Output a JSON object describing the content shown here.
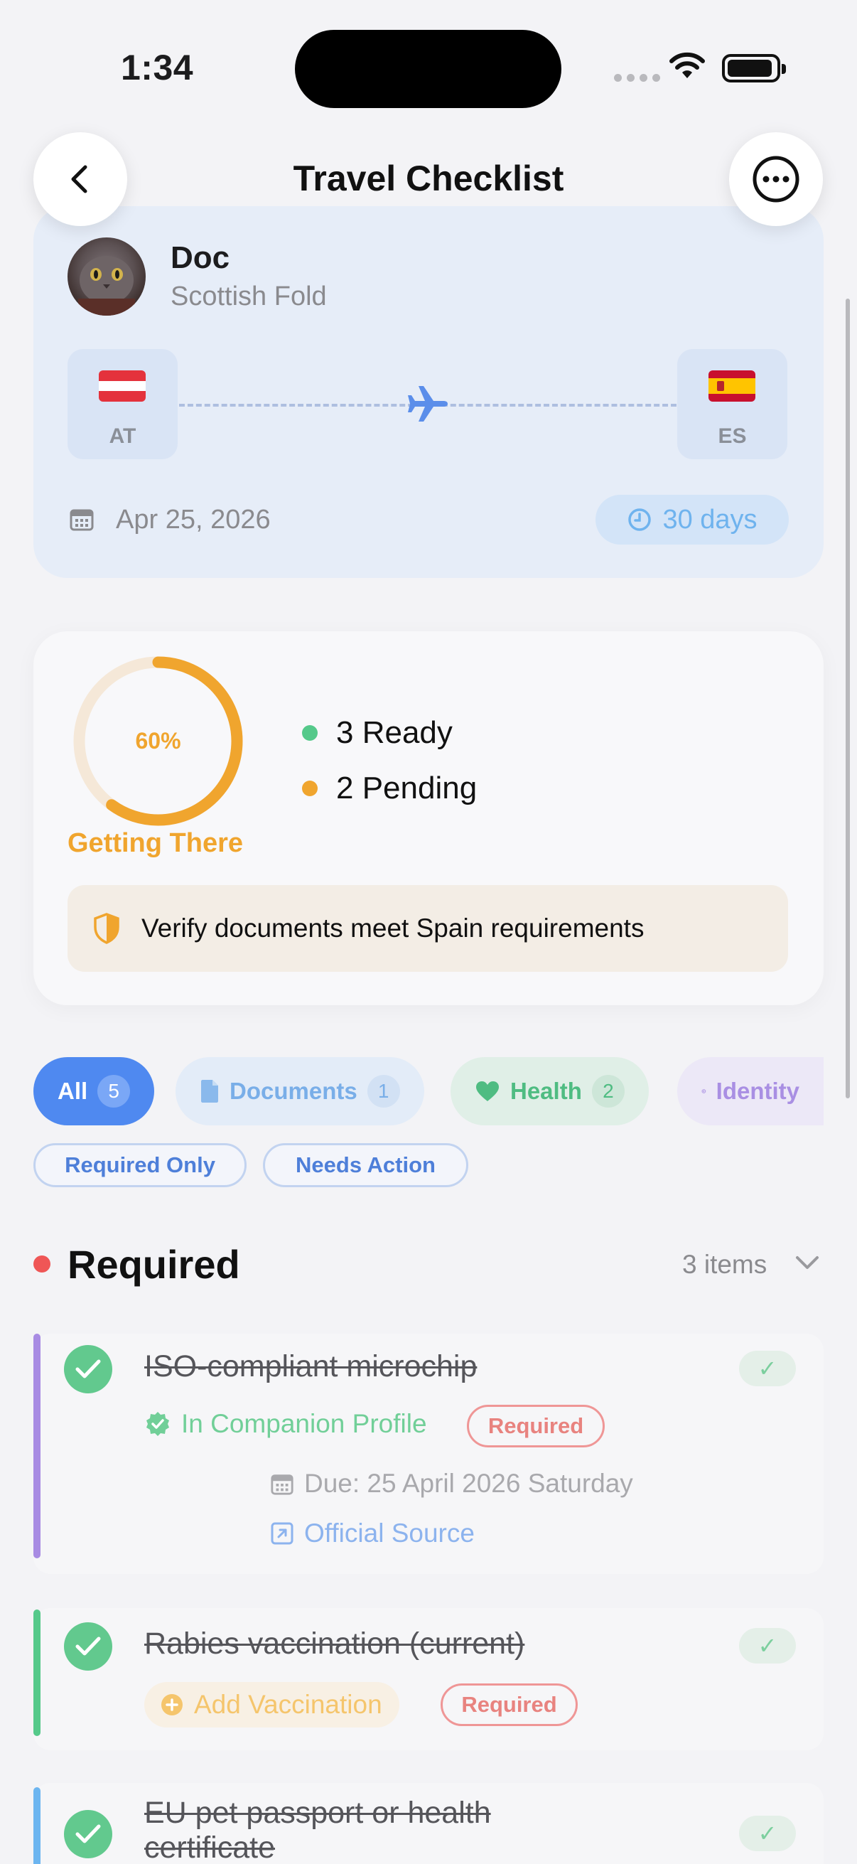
{
  "status_bar": {
    "time": "1:34"
  },
  "nav": {
    "title": "Travel Checklist"
  },
  "pet": {
    "name": "Doc",
    "breed": "Scottish Fold",
    "from_code": "AT",
    "to_code": "ES",
    "date": "Apr 25, 2026",
    "days": "30 days"
  },
  "progress": {
    "percent_label": "60%",
    "percent": 0.6,
    "status": "Getting There",
    "ready": "3 Ready",
    "pending": "2 Pending",
    "banner": "Verify documents meet Spain requirements"
  },
  "filters": {
    "all": {
      "label": "All",
      "count": "5"
    },
    "documents": {
      "label": "Documents",
      "count": "1"
    },
    "health": {
      "label": "Health",
      "count": "2"
    },
    "identity": {
      "label": "Identity"
    },
    "required_only": "Required Only",
    "needs_action": "Needs Action"
  },
  "section": {
    "title": "Required",
    "count": "3 items"
  },
  "items": [
    {
      "title": "ISO-compliant microchip",
      "status": "In Companion Profile",
      "tag": "Required",
      "due": "Due: 25 April 2026 Saturday",
      "source": "Official Source",
      "bar_color": "#a88be3"
    },
    {
      "title": "Rabies vaccination (current)",
      "action": "Add Vaccination",
      "tag": "Required",
      "bar_color": "#55c98a"
    },
    {
      "title_line1": "EU pet passport or health",
      "title_line2": "certificate",
      "bar_color": "#6cb5f0"
    }
  ],
  "colors": {
    "accent": "#4f89f0",
    "ready": "#55c98a",
    "pending": "#f0a52e",
    "required": "#ef5656"
  }
}
